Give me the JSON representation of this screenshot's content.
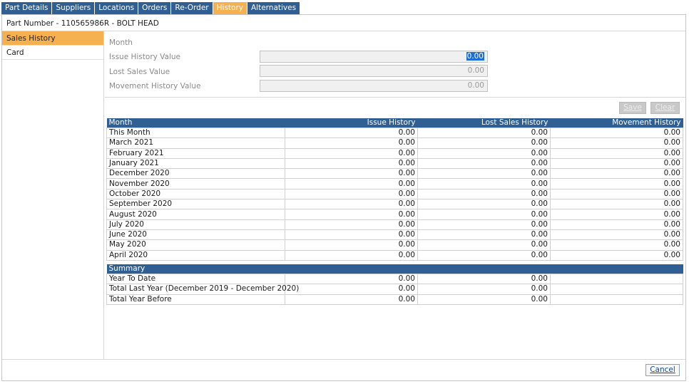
{
  "tabs": [
    "Part Details",
    "Suppliers",
    "Locations",
    "Orders",
    "Re-Order",
    "History",
    "Alternatives"
  ],
  "active_tab": "History",
  "header": {
    "title": "Part Number - 110565986R - BOLT HEAD"
  },
  "nav": {
    "items": [
      "Sales History",
      "Card"
    ],
    "active": "Sales History"
  },
  "form": {
    "month_label": "Month",
    "issue_label": "Issue History Value",
    "issue_value": "0.00",
    "lost_label": "Lost Sales Value",
    "lost_value": "0.00",
    "movement_label": "Movement History Value",
    "movement_value": "0.00"
  },
  "buttons": {
    "save": "Save",
    "clear": "Clear",
    "cancel": "Cancel"
  },
  "history_table": {
    "columns": [
      "Month",
      "Issue History",
      "Lost Sales History",
      "Movement History"
    ],
    "rows": [
      [
        "This Month",
        "0.00",
        "0.00",
        "0.00"
      ],
      [
        "March 2021",
        "0.00",
        "0.00",
        "0.00"
      ],
      [
        "February 2021",
        "0.00",
        "0.00",
        "0.00"
      ],
      [
        "January 2021",
        "0.00",
        "0.00",
        "0.00"
      ],
      [
        "December 2020",
        "0.00",
        "0.00",
        "0.00"
      ],
      [
        "November 2020",
        "0.00",
        "0.00",
        "0.00"
      ],
      [
        "October 2020",
        "0.00",
        "0.00",
        "0.00"
      ],
      [
        "September 2020",
        "0.00",
        "0.00",
        "0.00"
      ],
      [
        "August 2020",
        "0.00",
        "0.00",
        "0.00"
      ],
      [
        "July 2020",
        "0.00",
        "0.00",
        "0.00"
      ],
      [
        "June 2020",
        "0.00",
        "0.00",
        "0.00"
      ],
      [
        "May 2020",
        "0.00",
        "0.00",
        "0.00"
      ],
      [
        "April 2020",
        "0.00",
        "0.00",
        "0.00"
      ]
    ]
  },
  "summary_table": {
    "title": "Summary",
    "rows": [
      [
        "Year To Date",
        "0.00",
        "0.00",
        ""
      ],
      [
        "Total Last Year (December 2019 - December 2020)",
        "0.00",
        "0.00",
        ""
      ],
      [
        "Total Year Before",
        "0.00",
        "0.00",
        ""
      ]
    ]
  },
  "colors": {
    "tab_blue": "#2f5f93",
    "accent_orange": "#f5b050"
  }
}
